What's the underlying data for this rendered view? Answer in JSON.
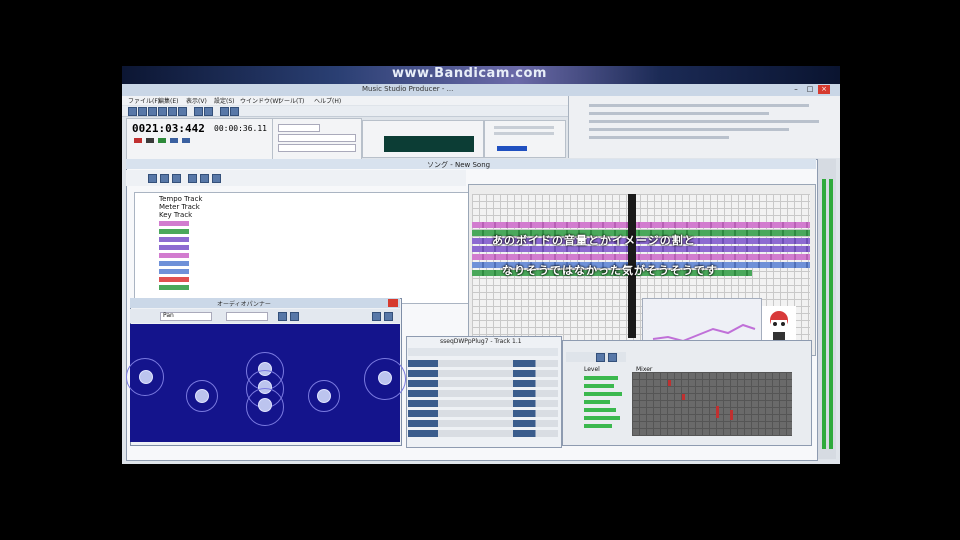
{
  "banner": {
    "text": "www.Bandicam.com"
  },
  "window": {
    "title": "Music Studio Producer - ...",
    "controls": {
      "minimize": "–",
      "maximize": "□",
      "close": "×"
    }
  },
  "menu": {
    "items": [
      "ファイル(F)",
      "編集(E)",
      "表示(V)",
      "設定(S)",
      "ウインドウ(W)",
      "ツール(T)",
      "ヘルプ(H)"
    ]
  },
  "transport": {
    "counter": "0021:03:442",
    "time": "00:00:36.11"
  },
  "song_window": {
    "title": "ソング - New Song"
  },
  "tracks": [
    {
      "label": "Tempo Track"
    },
    {
      "label": "Meter Track"
    },
    {
      "label": "Key Track"
    }
  ],
  "subtitles": {
    "line1": "あのボイドの音量とかイメージの割と",
    "line2": "なりそうではなかった気がそうそうです"
  },
  "panner": {
    "title": "オーディオパンナー",
    "mode": "Pan"
  },
  "instrument_window": {
    "title": "sseqDWPpPlug7 - Track 1.1"
  },
  "mixer": {
    "header_label": "Level",
    "header_grid": "Mixer"
  },
  "colors": {
    "banner": "#1b2a55",
    "panner_field": "#14148c",
    "clip_green": "#4aa85b",
    "clip_pink": "#d27ccf",
    "clip_purple": "#8d6bd1",
    "clip_blue": "#6f91d8",
    "spectrum": "#0c3d35",
    "vu_green": "#2faa3c",
    "close_red": "#d63a2e"
  }
}
